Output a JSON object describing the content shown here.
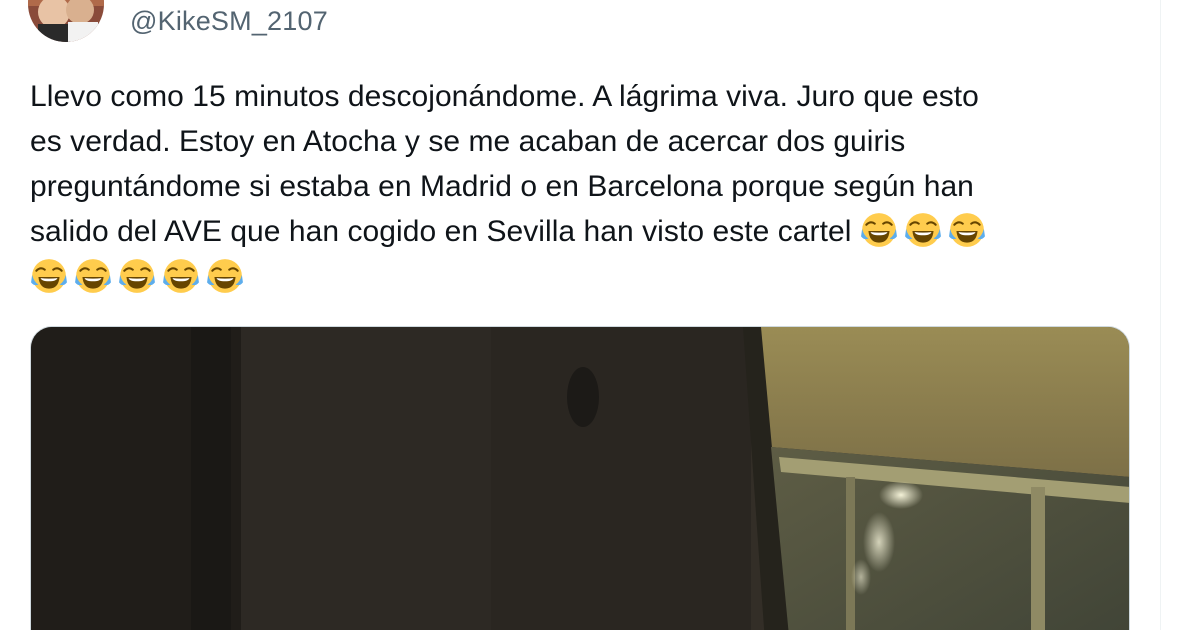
{
  "tweet": {
    "author_handle": "@KikeSM_2107",
    "text_lines": [
      "Llevo como 15 minutos descojonándome. A lágrima viva. Juro que esto",
      "es verdad. Estoy en Atocha y se me acaban de acercar dos guiris",
      "preguntándome si estaba en Madrid o en Barcelona porque según han",
      "salido del AVE que han cogido en Sevilla han visto este cartel"
    ],
    "emoji": {
      "name": "face-with-tears-of-joy-icon",
      "inline_count": 3,
      "trailing_count": 5
    }
  },
  "colors": {
    "text": "#0f1419",
    "handle": "#536471",
    "border": "#cfd9de"
  }
}
